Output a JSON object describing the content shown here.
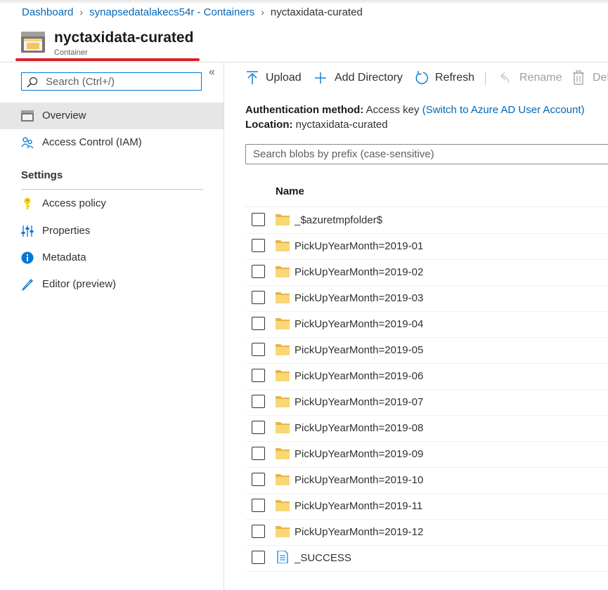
{
  "breadcrumb": {
    "items": [
      "Dashboard",
      "synapsedatalakecs54r - Containers"
    ],
    "current": "nyctaxidata-curated"
  },
  "header": {
    "title": "nyctaxidata-curated",
    "subtitle": "Container"
  },
  "sidebar": {
    "search_placeholder": "Search (Ctrl+/)",
    "collapse_glyph": "«",
    "items": [
      {
        "label": "Overview",
        "icon": "overview-icon",
        "active": true
      },
      {
        "label": "Access Control (IAM)",
        "icon": "people-icon"
      }
    ],
    "section_title": "Settings",
    "settings_items": [
      {
        "label": "Access policy",
        "icon": "key-icon"
      },
      {
        "label": "Properties",
        "icon": "sliders-icon"
      },
      {
        "label": "Metadata",
        "icon": "info-icon"
      },
      {
        "label": "Editor (preview)",
        "icon": "pencil-icon"
      }
    ]
  },
  "toolbar": {
    "upload": "Upload",
    "add_directory": "Add Directory",
    "refresh": "Refresh",
    "rename": "Rename",
    "delete": "Del"
  },
  "info": {
    "auth_label": "Authentication method:",
    "auth_value": "Access key",
    "auth_link": "(Switch to Azure AD User Account)",
    "location_label": "Location:",
    "location_value": "nyctaxidata-curated"
  },
  "blob_search_placeholder": "Search blobs by prefix (case-sensitive)",
  "table": {
    "column_name": "Name",
    "rows": [
      {
        "name": "_$azuretmpfolder$",
        "type": "folder"
      },
      {
        "name": "PickUpYearMonth=2019-01",
        "type": "folder"
      },
      {
        "name": "PickUpYearMonth=2019-02",
        "type": "folder"
      },
      {
        "name": "PickUpYearMonth=2019-03",
        "type": "folder"
      },
      {
        "name": "PickUpYearMonth=2019-04",
        "type": "folder"
      },
      {
        "name": "PickUpYearMonth=2019-05",
        "type": "folder"
      },
      {
        "name": "PickUpYearMonth=2019-06",
        "type": "folder"
      },
      {
        "name": "PickUpYearMonth=2019-07",
        "type": "folder"
      },
      {
        "name": "PickUpYearMonth=2019-08",
        "type": "folder"
      },
      {
        "name": "PickUpYearMonth=2019-09",
        "type": "folder"
      },
      {
        "name": "PickUpYearMonth=2019-10",
        "type": "folder"
      },
      {
        "name": "PickUpYearMonth=2019-11",
        "type": "folder"
      },
      {
        "name": "PickUpYearMonth=2019-12",
        "type": "folder"
      },
      {
        "name": "_SUCCESS",
        "type": "file"
      }
    ]
  },
  "colors": {
    "link": "#0067b8",
    "accent": "#0078d4",
    "highlight_underline": "#d8232a",
    "folder": "#f8d775",
    "active_nav_bg": "#e6e6e6"
  }
}
